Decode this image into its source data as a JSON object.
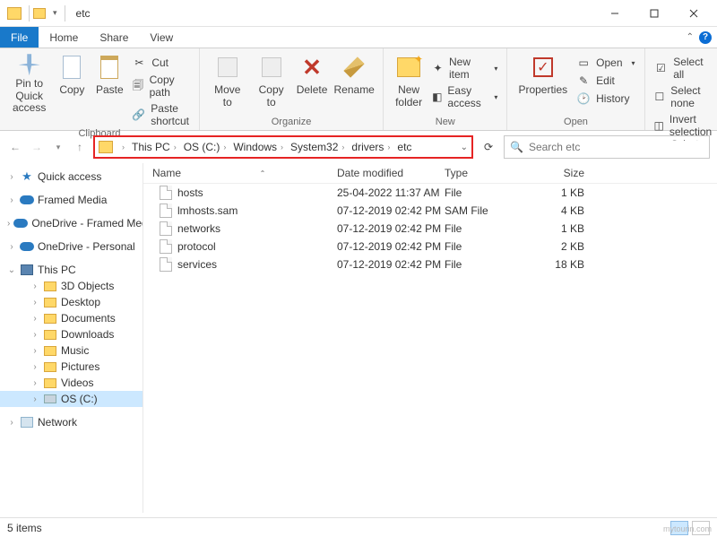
{
  "window": {
    "title": "etc"
  },
  "tabs": {
    "file": "File",
    "home": "Home",
    "share": "Share",
    "view": "View"
  },
  "ribbon": {
    "clipboard": {
      "label": "Clipboard",
      "pin": "Pin to Quick access",
      "copy": "Copy",
      "paste": "Paste",
      "cut": "Cut",
      "copy_path": "Copy path",
      "paste_shortcut": "Paste shortcut"
    },
    "organize": {
      "label": "Organize",
      "move_to": "Move to",
      "copy_to": "Copy to",
      "delete": "Delete",
      "rename": "Rename"
    },
    "new": {
      "label": "New",
      "new_folder": "New folder",
      "new_item": "New item",
      "easy_access": "Easy access"
    },
    "open": {
      "label": "Open",
      "properties": "Properties",
      "open": "Open",
      "edit": "Edit",
      "history": "History"
    },
    "select": {
      "label": "Select",
      "select_all": "Select all",
      "select_none": "Select none",
      "invert": "Invert selection"
    }
  },
  "breadcrumb": {
    "items": [
      "This PC",
      "OS (C:)",
      "Windows",
      "System32",
      "drivers",
      "etc"
    ]
  },
  "search": {
    "placeholder": "Search etc"
  },
  "tree": {
    "quick_access": "Quick access",
    "framed_media": "Framed Media",
    "onedrive_framed": "OneDrive - Framed Media",
    "onedrive_personal": "OneDrive - Personal",
    "this_pc": "This PC",
    "pc_children": [
      "3D Objects",
      "Desktop",
      "Documents",
      "Downloads",
      "Music",
      "Pictures",
      "Videos",
      "OS (C:)"
    ],
    "network": "Network"
  },
  "columns": {
    "name": "Name",
    "date": "Date modified",
    "type": "Type",
    "size": "Size"
  },
  "files": [
    {
      "name": "hosts",
      "date": "25-04-2022 11:37 AM",
      "type": "File",
      "size": "1 KB"
    },
    {
      "name": "lmhosts.sam",
      "date": "07-12-2019 02:42 PM",
      "type": "SAM File",
      "size": "4 KB"
    },
    {
      "name": "networks",
      "date": "07-12-2019 02:42 PM",
      "type": "File",
      "size": "1 KB"
    },
    {
      "name": "protocol",
      "date": "07-12-2019 02:42 PM",
      "type": "File",
      "size": "2 KB"
    },
    {
      "name": "services",
      "date": "07-12-2019 02:42 PM",
      "type": "File",
      "size": "18 KB"
    }
  ],
  "status": {
    "count": "5 items"
  },
  "watermark": "mytourin.com"
}
